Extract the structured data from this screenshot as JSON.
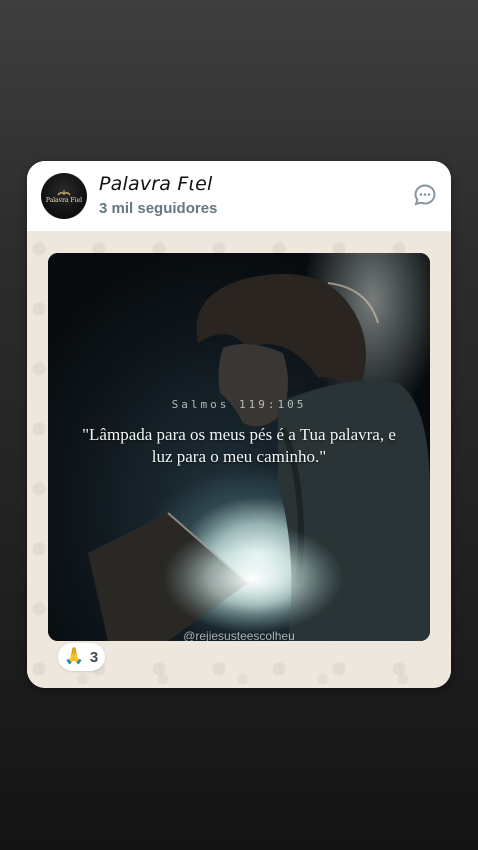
{
  "channel": {
    "name": "Palavra Fιel",
    "followers": "3 mil seguidores",
    "avatar_text": "Palavra Fiel"
  },
  "post": {
    "reference": "Salmos 119:105",
    "verse": "\"Lâmpada para os meus pés é a Tua palavra, e luz para o meu caminho.\"",
    "watermark": "@rejiesusteescolheu"
  },
  "reaction": {
    "emoji": "🙏",
    "count": "3"
  },
  "icons": {
    "reply": "message-reply-icon",
    "reaction": "praying-hands-icon"
  }
}
